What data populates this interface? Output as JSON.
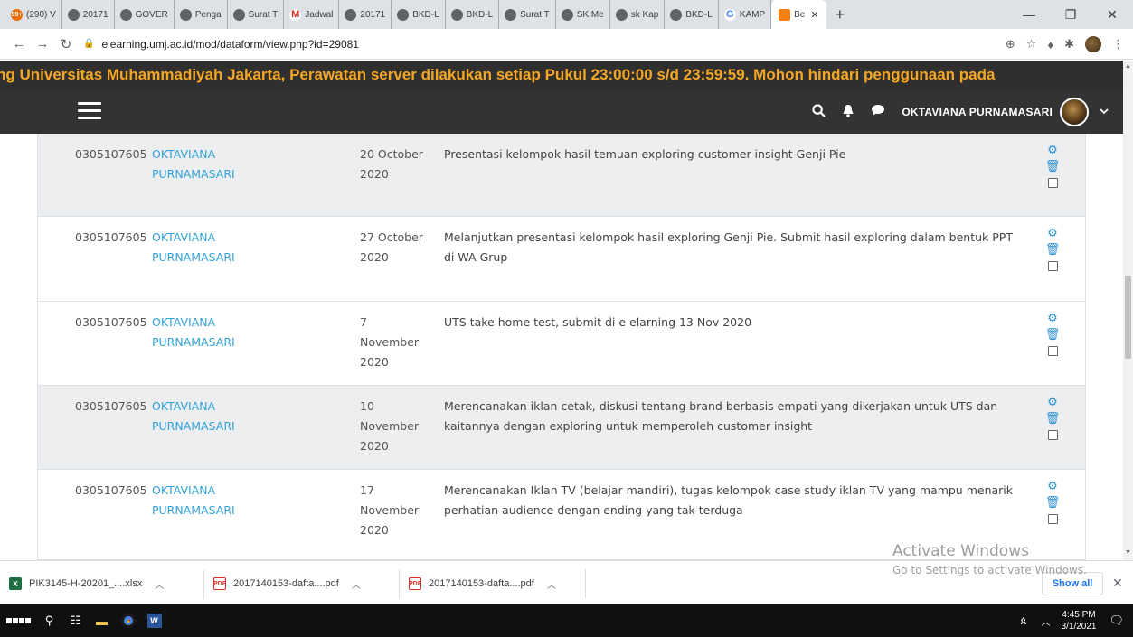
{
  "browser": {
    "tabs": [
      {
        "label": "(290) V",
        "badge": "99+"
      },
      {
        "label": "20171"
      },
      {
        "label": "GOVER"
      },
      {
        "label": "Penga"
      },
      {
        "label": "Surat T"
      },
      {
        "label": "Jadwal"
      },
      {
        "label": "20171"
      },
      {
        "label": "BKD-L"
      },
      {
        "label": "BKD-L"
      },
      {
        "label": "Surat T"
      },
      {
        "label": "SK Me"
      },
      {
        "label": "sk Kap"
      },
      {
        "label": "BKD-L"
      },
      {
        "label": "KAMP"
      }
    ],
    "active_tab": {
      "label": "Be"
    },
    "url": "elearning.umj.ac.id/mod/dataform/view.php?id=29081"
  },
  "banner": {
    "text": "ng Universitas Muhammadiyah Jakarta, Perawatan server dilakukan setiap Pukul 23:00:00 s/d 23:59:59. Mohon hindari penggunaan pada"
  },
  "navbar": {
    "username": "OKTAVIANA PURNAMASARI"
  },
  "rows": [
    {
      "id": "0305107605",
      "name1": "OKTAVIANA",
      "name2": "PURNAMASARI",
      "date1": "20 October",
      "date2": "2020",
      "date3": "",
      "desc1": "Presentasi kelompok hasil temuan exploring customer insight Genji Pie",
      "desc2": ""
    },
    {
      "id": "0305107605",
      "name1": "OKTAVIANA",
      "name2": "PURNAMASARI",
      "date1": "27 October",
      "date2": "2020",
      "date3": "",
      "desc1": "Melanjutkan presentasi kelompok hasil exploring Genji Pie. Submit hasil exploring dalam bentuk PPT",
      "desc2": "di WA Grup"
    },
    {
      "id": "0305107605",
      "name1": "OKTAVIANA",
      "name2": "PURNAMASARI",
      "date1": "7",
      "date2": "November",
      "date3": "2020",
      "desc1": "UTS take home test, submit di e elarning 13 Nov 2020",
      "desc2": ""
    },
    {
      "id": "0305107605",
      "name1": "OKTAVIANA",
      "name2": "PURNAMASARI",
      "date1": "10",
      "date2": "November",
      "date3": "2020",
      "desc1": "Merencanakan iklan cetak, diskusi tentang brand berbasis empati yang dikerjakan untuk UTS dan",
      "desc2": "kaitannya dengan exploring untuk memperoleh customer insight"
    },
    {
      "id": "0305107605",
      "name1": "OKTAVIANA",
      "name2": "PURNAMASARI",
      "date1": "17",
      "date2": "November",
      "date3": "2020",
      "desc1": "Merencanakan Iklan TV  (belajar mandiri), tugas kelompok case study iklan TV yang  mampu menarik",
      "desc2": "perhatian audience dengan ending yang tak terduga"
    }
  ],
  "activate": {
    "line1": "Activate Windows",
    "line2": "Go to Settings to activate Windows."
  },
  "downloads": {
    "items": [
      {
        "name": "PIK3145-H-20201_....xlsx"
      },
      {
        "name": "2017140153-dafta....pdf"
      },
      {
        "name": "2017140153-dafta....pdf"
      }
    ],
    "show_all": "Show all"
  },
  "taskbar": {
    "time": "4:45 PM",
    "date": "3/1/2021"
  }
}
